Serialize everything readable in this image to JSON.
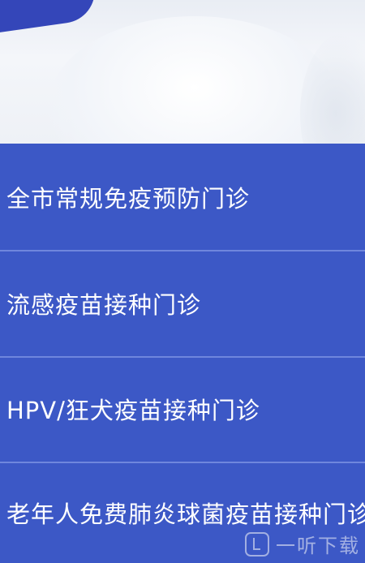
{
  "menu": {
    "items": [
      {
        "label": "全市常规免疫预防门诊"
      },
      {
        "label": "流感疫苗接种门诊"
      },
      {
        "label": "HPV/狂犬疫苗接种门诊"
      },
      {
        "label": "老年人免费肺炎球菌疫苗接种门诊"
      }
    ]
  },
  "watermark": {
    "text": "一听下载"
  },
  "colors": {
    "menu_background": "#3c58c6",
    "divider": "#6f86dd",
    "text": "#ffffff"
  }
}
